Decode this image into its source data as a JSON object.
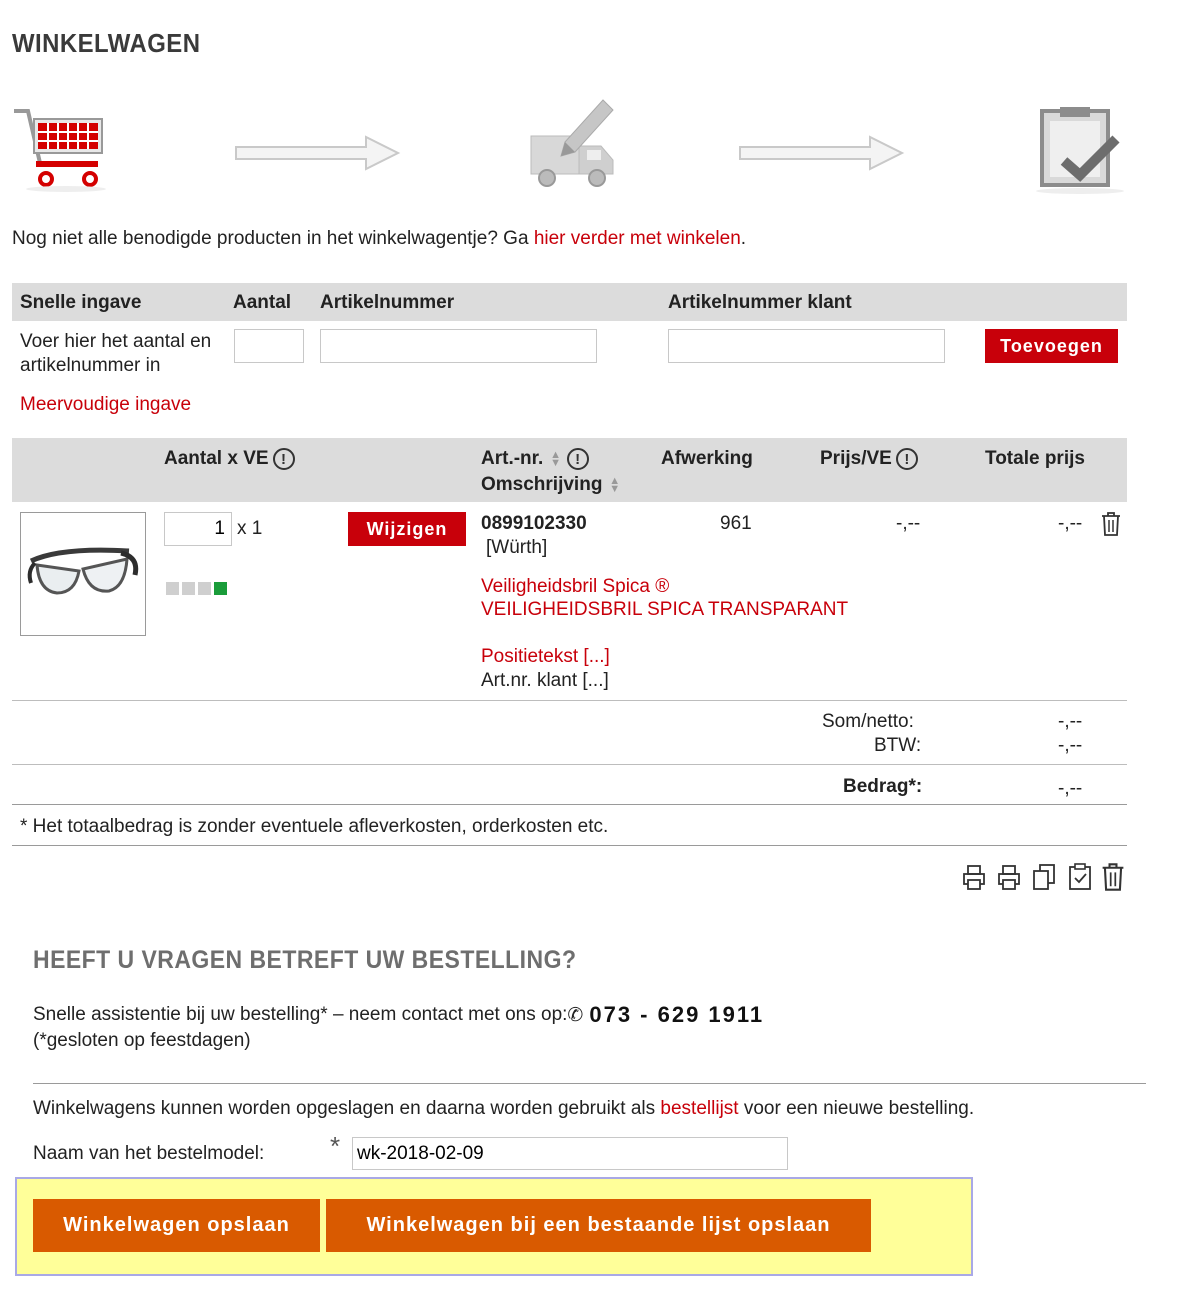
{
  "page": {
    "title": "WINKELWAGEN"
  },
  "intro": {
    "text": "Nog niet alle benodigde producten in het winkelwagentje? Ga ",
    "link": "hier verder met winkelen",
    "end": "."
  },
  "quick_entry": {
    "headers": {
      "label": "Snelle ingave",
      "qty": "Aantal",
      "article": "Artikelnummer",
      "article_customer": "Artikelnummer klant"
    },
    "hint": "Voer hier het aantal en artikelnummer in",
    "qty_value": "",
    "article_value": "",
    "article_customer_value": "",
    "add_button": "Toevoegen",
    "multi_link": "Meervoudige ingave"
  },
  "cart_table": {
    "headers": {
      "qty": "Aantal x VE",
      "artnr": "Art.-nr.",
      "description": "Omschrijving",
      "finish": "Afwerking",
      "price": "Prijs/VE",
      "total": "Totale prijs"
    },
    "items": [
      {
        "qty": "1",
        "unit": "x 1",
        "change_button": "Wijzigen",
        "artnr": "0899102330",
        "brand": "[Würth]",
        "name": "Veiligheidsbril Spica ®",
        "name_detail": "VEILIGHEIDSBRIL SPICA TRANSPARANT",
        "position_text": "Positietekst [...]",
        "customer_artnr": "Art.nr. klant [...]",
        "finish": "961",
        "price": "-,--",
        "total": "-,--",
        "availability": 4,
        "availability_level": 1
      }
    ]
  },
  "totals": {
    "sum_label": "Som/netto:",
    "sum_value": "-,--",
    "vat_label": "BTW:",
    "vat_value": "-,--",
    "amount_label": "Bedrag*:",
    "amount_value": "-,--"
  },
  "footnote": "* Het totaalbedrag is zonder eventuele afleverkosten, orderkosten etc.",
  "toolbar_icons": [
    "print-icon",
    "print-icon",
    "copy-icon",
    "clipboard-check-icon",
    "trash-icon"
  ],
  "questions": {
    "title": "HEEFT U VRAGEN BETREFT UW BESTELLING?",
    "text": "Snelle assistentie bij uw bestelling* – neem contact met ons op: ",
    "phone": "073 - 629 1911",
    "note": "(*gesloten op feestdagen)"
  },
  "save": {
    "text": "Winkelwagens kunnen worden opgeslagen en daarna worden gebruikt als ",
    "link": "bestellijst",
    "text_end": " voor een nieuwe bestelling.",
    "name_label": "Naam van het bestelmodel:",
    "required_mark": "*",
    "name_value": "wk-2018-02-09",
    "save_button": "Winkelwagen opslaan",
    "save_existing_button": "Winkelwagen bij een bestaande lijst opslaan"
  },
  "colors": {
    "accent_red": "#c8000a",
    "accent_orange": "#d95a00",
    "header_gray": "#dcdcdc",
    "highlight_yellow": "#ffff99"
  }
}
